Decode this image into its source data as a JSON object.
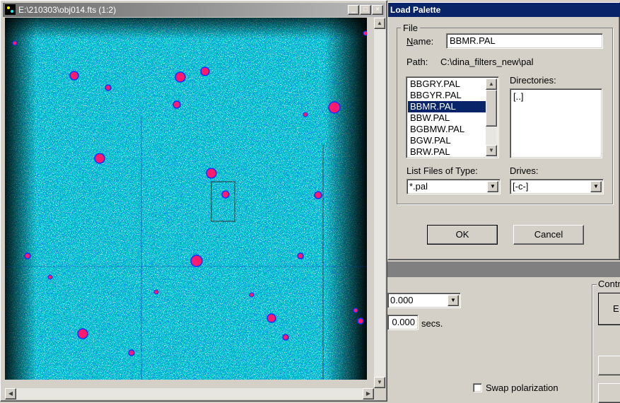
{
  "image_window": {
    "title": "E:\\210303\\obj014.fts (1:2)",
    "controls": {
      "minimize": "_",
      "maximize": "□",
      "close": "×"
    }
  },
  "dialog": {
    "title": "Load Palette",
    "file_group": "File",
    "name_label": "Name:",
    "name_value": "BBMR.PAL",
    "path_label": "Path:",
    "path_value": "C:\\dina_filters_new\\pal",
    "files": [
      "BBGRY.PAL",
      "BBGYR.PAL",
      "BBMR.PAL",
      "BBW.PAL",
      "BGBMW.PAL",
      "BGW.PAL",
      "BRW.PAL"
    ],
    "selected_index": 2,
    "directories_label": "Directories:",
    "directories": [
      "[..]"
    ],
    "type_label": "List Files of Type:",
    "type_value": "*.pal",
    "drives_label": "Drives:",
    "drives_value": "[-c-]",
    "ok": "OK",
    "cancel": "Cancel"
  },
  "lower_panel": {
    "value1": "0.000",
    "value2": "0.000",
    "secs": "secs.",
    "swap_label": "Swap polarization",
    "contr_label": "Contr",
    "e_button": "E"
  },
  "colors": {
    "sky": "#00c8c8",
    "star": "#ff1a6e",
    "title_active": "#0a246a"
  }
}
